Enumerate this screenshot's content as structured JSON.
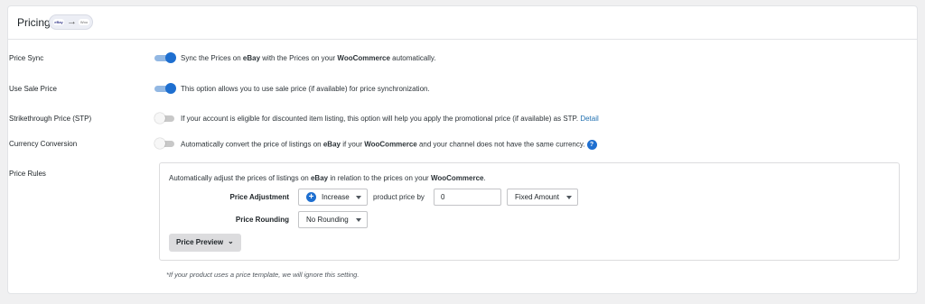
{
  "section": {
    "title": "Pricing",
    "flow_src": "eBay",
    "flow_dst": "Woo"
  },
  "rows": {
    "price_sync": {
      "label": "Price Sync",
      "enabled": true,
      "desc_1": "Sync the Prices on ",
      "desc_b1": "eBay",
      "desc_2": " with the Prices on your ",
      "desc_b2": "WooCommerce",
      "desc_3": " automatically."
    },
    "sale_price": {
      "label": "Use Sale Price",
      "enabled": true,
      "desc": "This option allows you to use sale price (if available) for price synchronization."
    },
    "stp": {
      "label": "Strikethrough Price (STP)",
      "enabled": false,
      "desc": "If your account is eligible for discounted item listing, this option will help you apply the promotional price (if available) as STP.",
      "link": "Detail"
    },
    "currency": {
      "label": "Currency Conversion",
      "enabled": false,
      "desc_1": "Automatically convert the price of listings on ",
      "desc_b1": "eBay",
      "desc_2": " if your ",
      "desc_b2": "WooCommerce",
      "desc_3": " and your channel does not have the same currency.",
      "help": "?"
    }
  },
  "price_rules": {
    "label": "Price Rules",
    "intro_1": "Automatically adjust the prices of listings on ",
    "intro_b1": "eBay",
    "intro_2": " in relation to the prices on your ",
    "intro_b2": "WooCommerce",
    "intro_3": ".",
    "adjustment_label": "Price Adjustment",
    "adjustment_direction": "Increase",
    "by_text": "product price by",
    "amount_value": "0",
    "amount_type": "Fixed Amount",
    "rounding_label": "Price Rounding",
    "rounding_value": "No Rounding",
    "preview_button": "Price Preview",
    "footnote": "*If your product uses a price template, we will ignore this setting."
  },
  "colors": {
    "accent": "#1e6fd0",
    "toggle_on_track": "#93b8e3",
    "toggle_off_track": "#c8c8c8"
  }
}
